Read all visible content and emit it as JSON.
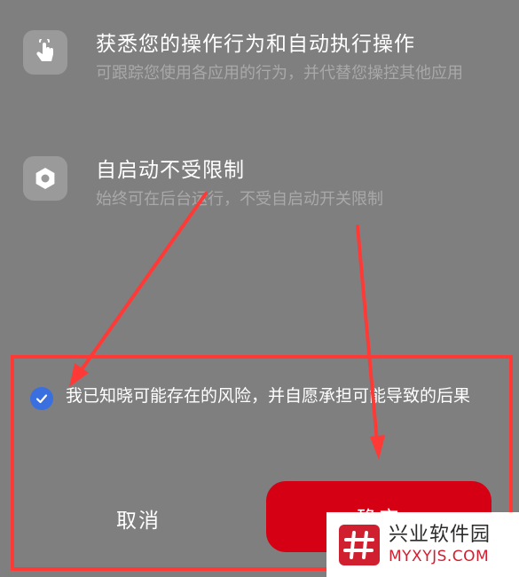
{
  "permissions": [
    {
      "icon": "touch-icon",
      "title": "获悉您的操作行为和自动执行操作",
      "description": "可跟踪您使用各应用的行为，并代替您操控其他应用"
    },
    {
      "icon": "hexagon-icon",
      "title": "自启动不受限制",
      "description": "始终可在后台运行，不受自启动开关限制"
    }
  ],
  "consent": {
    "checked": true,
    "text": "我已知晓可能存在的风险，并自愿承担可能导致的后果"
  },
  "buttons": {
    "cancel_label": "取消",
    "confirm_label": "确定"
  },
  "watermark": {
    "name": "兴业软件园",
    "url": "MYXYJS.COM"
  },
  "colors": {
    "background": "#7f7f7f",
    "annotation": "#ff3a36",
    "confirm": "#d50013",
    "checkbox": "#3a6fe0"
  }
}
